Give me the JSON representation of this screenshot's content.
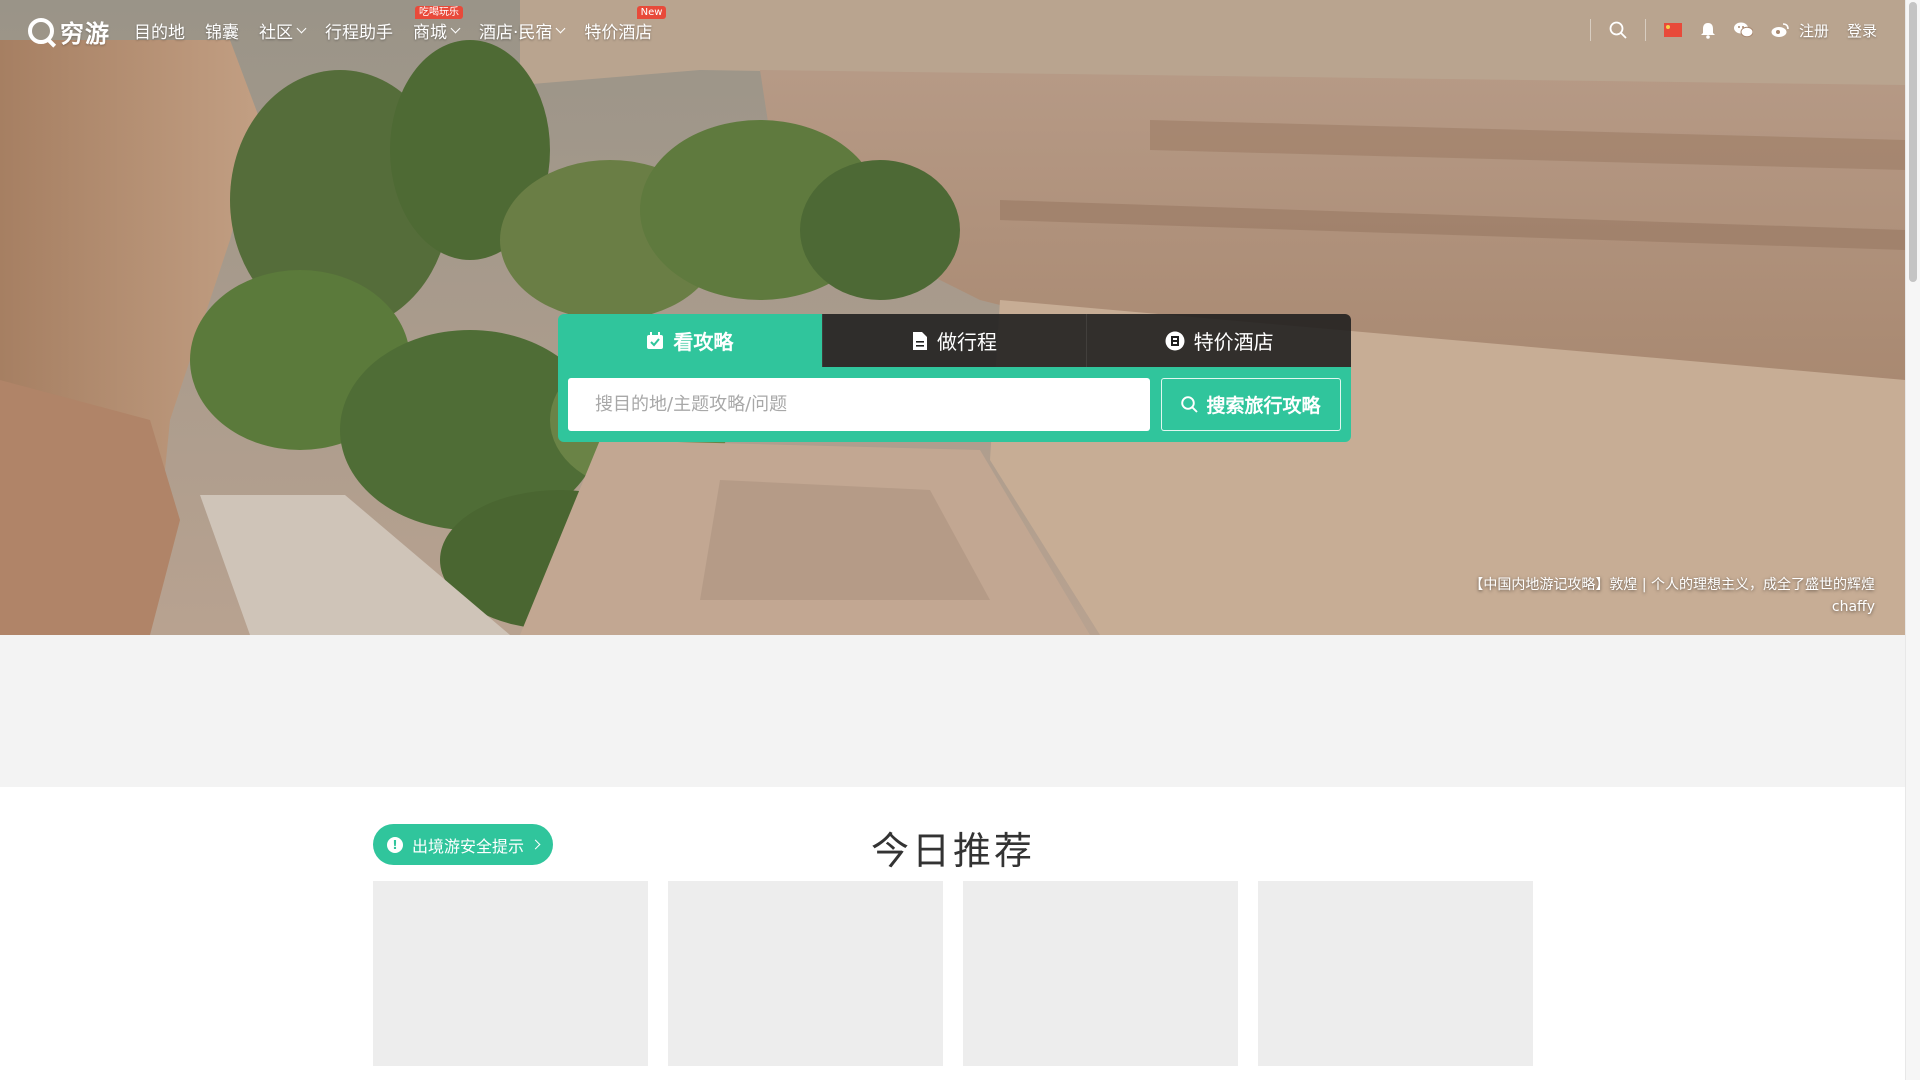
{
  "brand": {
    "name": "穷游"
  },
  "nav": {
    "items": [
      {
        "label": "目的地",
        "has_dropdown": false,
        "badge": ""
      },
      {
        "label": "锦囊",
        "has_dropdown": false,
        "badge": ""
      },
      {
        "label": "社区",
        "has_dropdown": true,
        "badge": ""
      },
      {
        "label": "行程助手",
        "has_dropdown": false,
        "badge": ""
      },
      {
        "label": "商城",
        "has_dropdown": true,
        "badge": "吃喝玩乐"
      },
      {
        "label": "酒店·民宿",
        "has_dropdown": true,
        "badge": ""
      },
      {
        "label": "特价酒店",
        "has_dropdown": false,
        "badge": "New"
      }
    ],
    "register_label": "注册",
    "login_label": "登录",
    "icons": [
      "search-icon",
      "flag-icon",
      "bell-icon",
      "wechat-icon",
      "weibo-icon"
    ]
  },
  "search": {
    "tabs": [
      {
        "label": "看攻略",
        "icon": "calendar-icon",
        "active": true
      },
      {
        "label": "做行程",
        "icon": "document-icon",
        "active": false
      },
      {
        "label": "特价酒店",
        "icon": "hotel-icon",
        "active": false
      }
    ],
    "placeholder": "搜目的地/主题攻略/问题",
    "value": "",
    "button_label": "搜索旅行攻略"
  },
  "hero_caption": {
    "title": "【中国内地游记攻略】敦煌 | 个人的理想主义，成全了盛世的辉煌",
    "author": "chaffy"
  },
  "recommend": {
    "safety_label": "出境游安全提示",
    "title": "今日推荐",
    "cards": [
      {},
      {},
      {},
      {}
    ]
  },
  "colors": {
    "accent": "#30c59c",
    "badge": "#e84a3a",
    "tab_inactive": "#1e1e1e",
    "placeholder_card": "#ededed"
  }
}
